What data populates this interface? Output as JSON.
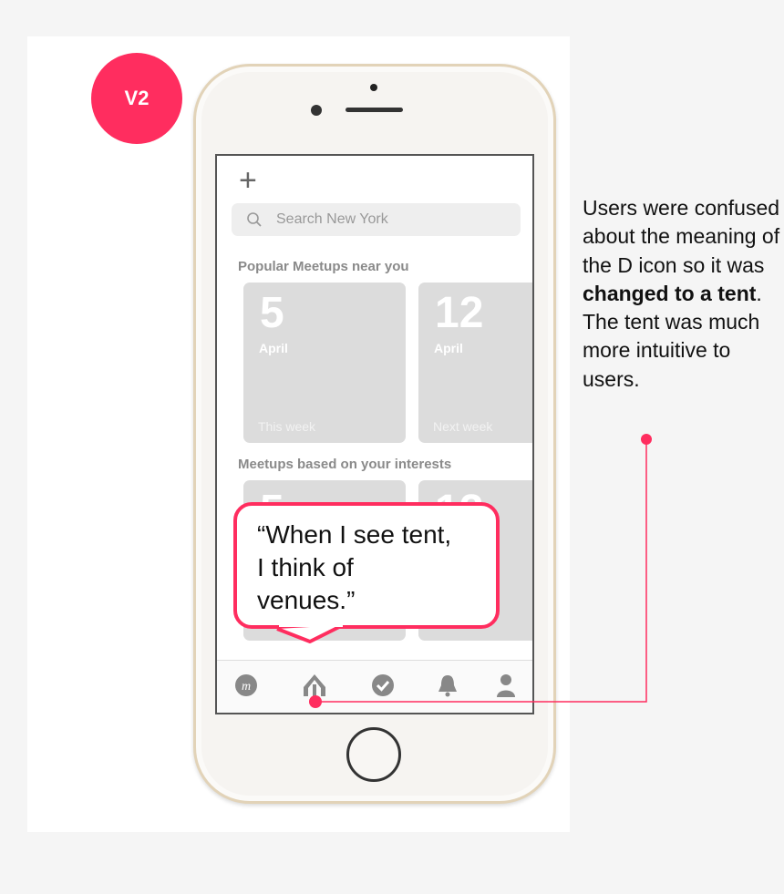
{
  "badge": "V2",
  "app": {
    "search_placeholder": "Search New York",
    "sections": [
      {
        "title": "Popular Meetups near you",
        "cards": [
          {
            "day": "5",
            "month": "April",
            "when": "This week"
          },
          {
            "day": "12",
            "month": "April",
            "when": "Next week"
          }
        ]
      },
      {
        "title": "Meetups based on your interests",
        "cards": [
          {
            "day": "5"
          },
          {
            "day": "12"
          }
        ]
      }
    ],
    "tabs": [
      "meetup-logo-icon",
      "tent-icon",
      "check-circle-icon",
      "bell-icon",
      "user-icon"
    ]
  },
  "quote": {
    "line1": "“When I see tent,",
    "line2": "I think of",
    "line3": "venues.”"
  },
  "note": {
    "pre": "Users were confused about the meaning of the D icon so it was ",
    "bold": "changed to a tent",
    "post": ". The tent was much more intuitive to users."
  },
  "colors": {
    "accent": "#ff2d5f",
    "card": "#dcdcdc"
  }
}
